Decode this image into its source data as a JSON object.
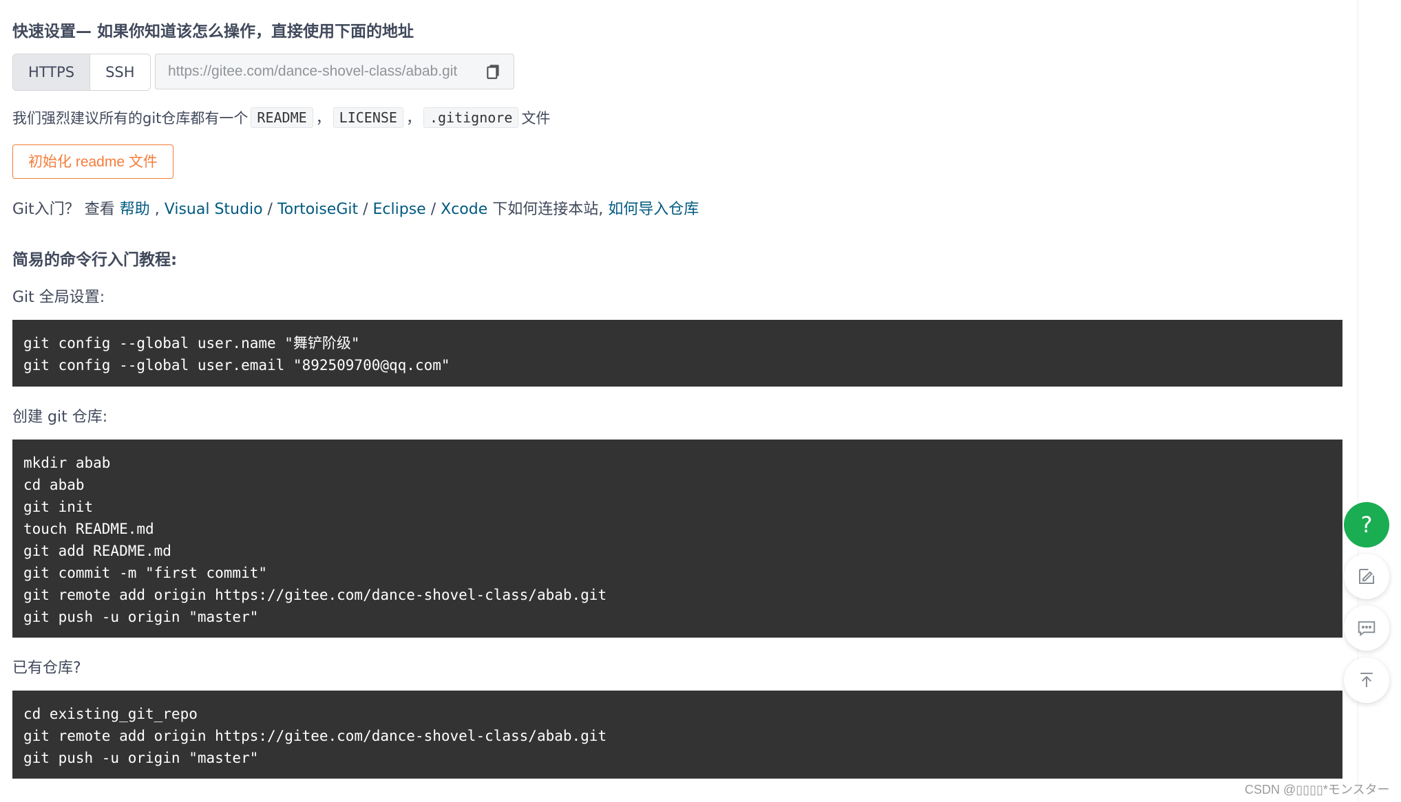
{
  "quick_setup": {
    "title": "快速设置— 如果你知道该怎么操作，直接使用下面的地址",
    "protocols": [
      "HTTPS",
      "SSH"
    ],
    "url_value": "https://gitee.com/dance-shovel-class/abab.git"
  },
  "recommend": {
    "prefix": "我们强烈建议所有的git仓库都有一个",
    "files": [
      "README",
      "LICENSE",
      ".gitignore"
    ],
    "sep": "，",
    "suffix": "文件"
  },
  "init_button": "初始化 readme 文件",
  "help_line": {
    "prefix": "Git入门？ 查看 ",
    "help": "帮助",
    "sep1": " , ",
    "vs": "Visual Studio",
    "slash1": " / ",
    "tortoise": "TortoiseGit",
    "slash2": " / ",
    "eclipse": "Eclipse",
    "slash3": " / ",
    "xcode": "Xcode",
    "mid": " 下如何连接本站, ",
    "import": "如何导入仓库"
  },
  "tutorial": {
    "title": "简易的命令行入门教程:",
    "global_label": "Git 全局设置:",
    "global_cmds": [
      "git config --global user.name \"舞铲阶级\"",
      "git config --global user.email \"892509700@qq.com\""
    ],
    "create_label": "创建 git 仓库:",
    "create_cmds": [
      "mkdir abab",
      "cd abab",
      "git init",
      "touch README.md",
      "git add README.md",
      "git commit -m \"first commit\"",
      "git remote add origin https://gitee.com/dance-shovel-class/abab.git",
      "git push -u origin \"master\""
    ],
    "existing_label": "已有仓库?",
    "existing_cmds": [
      "cd existing_git_repo",
      "git remote add origin https://gitee.com/dance-shovel-class/abab.git",
      "git push -u origin \"master\""
    ]
  },
  "float_buttons": {
    "help_text": "?",
    "icons": [
      "question-icon",
      "edit-icon",
      "comment-icon",
      "back-to-top-icon"
    ],
    "help_color": "#1aad52"
  },
  "watermark": "CSDN @▯▯▯▯*モンスター",
  "colors": {
    "link": "#005980",
    "accent_orange": "#f57c3a",
    "code_bg": "#333333"
  }
}
